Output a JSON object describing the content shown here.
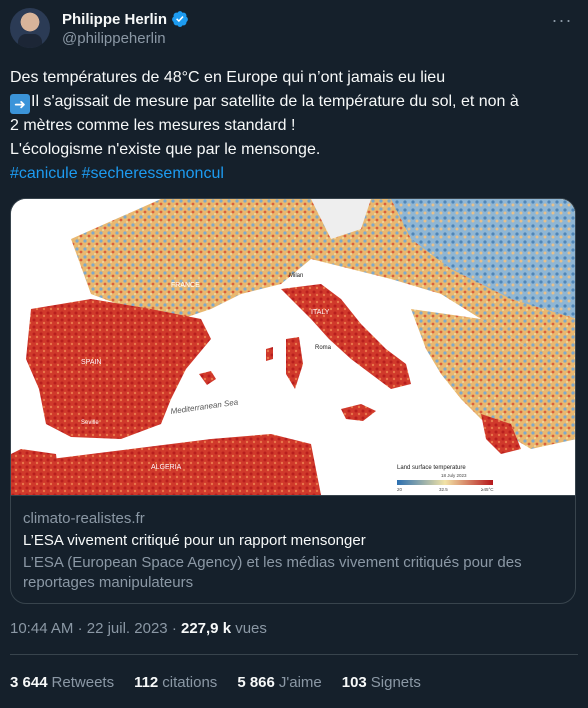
{
  "author": {
    "display_name": "Philippe Herlin",
    "handle": "@philippeherlin"
  },
  "tweet": {
    "line1": "Des températures de 48°C en Europe qui n’ont jamais eu lieu",
    "line2": "Il s'agissait de mesure par satellite de la température du sol, et non à",
    "line3": "2 mètres comme les mesures standard !",
    "line4": "L'écologisme n'existe que par le mensonge.",
    "hashtags": [
      "#canicule",
      "#secheressemoncul"
    ]
  },
  "card": {
    "map": {
      "labels": {
        "france": "FRANCE",
        "italy": "ITALY",
        "spain": "SPAIN",
        "algeria": "ALGERIA",
        "milan": "Milan",
        "rome": "Roma",
        "seville": "Seville",
        "sea": "Mediterranean Sea"
      },
      "legend": {
        "title": "Land surface temperature",
        "date": "18 July 2023",
        "min": "20",
        "mid": "32.5",
        "max": "≥45°C"
      }
    },
    "domain": "climato-realistes.fr",
    "title": "L’ESA vivement critiqué pour un rapport mensonger",
    "description": "L’ESA (European Space Agency) et les médias vivement critiqués pour des reportages manipulateurs"
  },
  "meta": {
    "time": "10:44 AM",
    "separator": "·",
    "date": "22 juil. 2023",
    "views_count": "227,9 k",
    "views_label": "vues"
  },
  "stats": {
    "retweets_count": "3 644",
    "retweets_label": "Retweets",
    "quotes_count": "112",
    "quotes_label": "citations",
    "likes_count": "5 866",
    "likes_label": "J'aime",
    "bookmarks_count": "103",
    "bookmarks_label": "Signets"
  },
  "colors": {
    "background": "#15202b",
    "text": "#f7f9f9",
    "muted": "#8b98a5",
    "link": "#1d9bf0",
    "border": "#38444d",
    "verified": "#1d9bf0"
  }
}
